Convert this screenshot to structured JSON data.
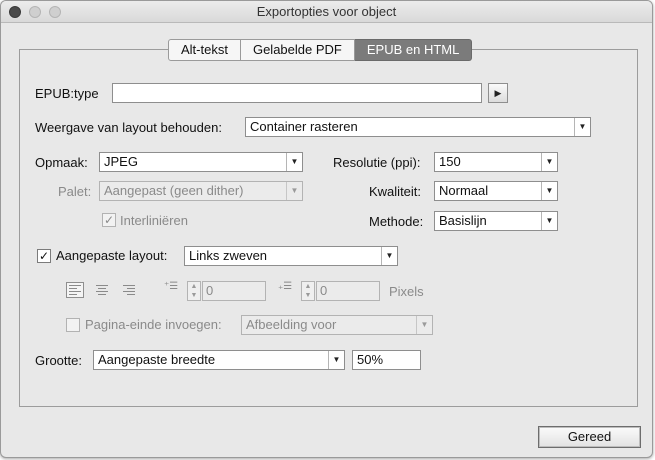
{
  "window": {
    "title": "Exportopties voor object"
  },
  "tabs": [
    {
      "label": "Alt-tekst",
      "active": false
    },
    {
      "label": "Gelabelde PDF",
      "active": false
    },
    {
      "label": "EPUB en HTML",
      "active": true
    }
  ],
  "epub_type": {
    "label": "EPUB:type",
    "value": ""
  },
  "layout_keep": {
    "label": "Weergave van layout behouden:",
    "value": "Container rasteren"
  },
  "format": {
    "label": "Opmaak:",
    "value": "JPEG"
  },
  "palette": {
    "label": "Palet:",
    "value": "Aangepast (geen dither)"
  },
  "interlace": {
    "label": "Interliniëren",
    "checked": true,
    "enabled": false
  },
  "resolution": {
    "label": "Resolutie (ppi):",
    "value": "150"
  },
  "quality": {
    "label": "Kwaliteit:",
    "value": "Normaal"
  },
  "method": {
    "label": "Methode:",
    "value": "Basislijn"
  },
  "custom_layout": {
    "label": "Aangepaste layout:",
    "checked": true,
    "value": "Links zweven"
  },
  "spacing": {
    "before": "0",
    "after": "0",
    "unit": "Pixels"
  },
  "page_break": {
    "label": "Pagina-einde invoegen:",
    "checked": false,
    "value": "Afbeelding voor"
  },
  "size": {
    "label": "Grootte:",
    "value": "Aangepaste breedte",
    "percent": "50%"
  },
  "done_button": {
    "label": "Gereed"
  },
  "colors": {
    "active_tab": "#7b7b7b",
    "disabled_text": "#8a8a8a",
    "window_bg": "#e8e8e8"
  }
}
